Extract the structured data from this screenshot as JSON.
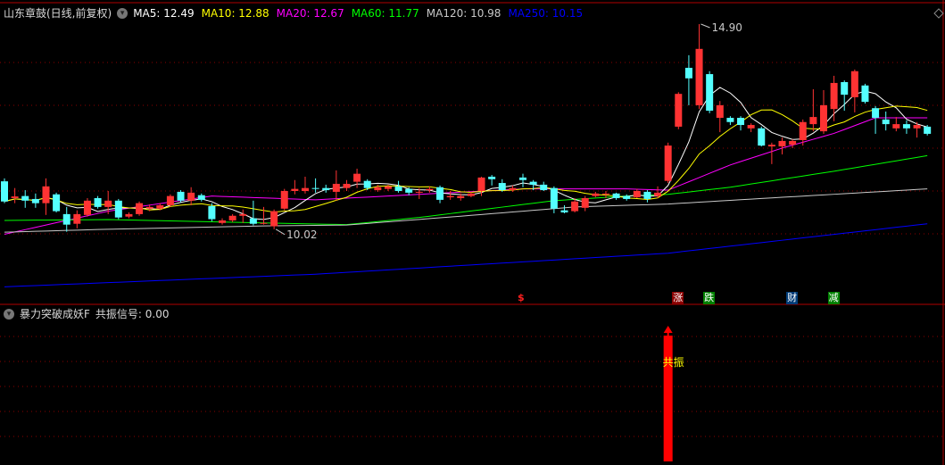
{
  "header": {
    "title": "山东章鼓(日线,前复权)",
    "ma_labels": [
      {
        "text": "MA5: 12.49",
        "color": "#ffffff"
      },
      {
        "text": "MA10: 12.88",
        "color": "#ffff00"
      },
      {
        "text": "MA20: 12.67",
        "color": "#ff00ff"
      },
      {
        "text": "MA60: 11.77",
        "color": "#00ff00"
      },
      {
        "text": "MA120: 10.98",
        "color": "#c8c8c8"
      },
      {
        "text": "MA250: 10.15",
        "color": "#0000ff"
      }
    ]
  },
  "indicator": {
    "title": "暴力突破成妖F",
    "value_label": "共振信号: 0.00",
    "bar_label": "共振"
  },
  "colors": {
    "up": "#ff3333",
    "down": "#54ffff",
    "grid": "#8b0000",
    "border": "#b00000"
  },
  "chart_data": {
    "type": "candlestick",
    "title": "山东章鼓(日线,前复权)",
    "price_range": [
      8.57,
      15.47
    ],
    "annotations": [
      {
        "label": "14.90",
        "index": 67,
        "price": 14.9,
        "kind": "high"
      },
      {
        "label": "10.02",
        "index": 26,
        "price": 10.02,
        "kind": "low"
      }
    ],
    "candles": [
      [
        11.16,
        11.23,
        10.64,
        10.68
      ],
      [
        10.76,
        11.0,
        10.64,
        10.8
      ],
      [
        10.81,
        10.95,
        10.53,
        10.7
      ],
      [
        10.74,
        10.87,
        10.53,
        10.64
      ],
      [
        10.64,
        11.23,
        10.36,
        11.04
      ],
      [
        10.85,
        10.89,
        10.42,
        10.45
      ],
      [
        10.38,
        10.55,
        9.96,
        10.13
      ],
      [
        10.15,
        10.47,
        10.04,
        10.38
      ],
      [
        10.36,
        10.76,
        10.32,
        10.7
      ],
      [
        10.76,
        10.81,
        10.51,
        10.55
      ],
      [
        10.55,
        10.93,
        10.38,
        10.7
      ],
      [
        10.7,
        10.74,
        10.26,
        10.3
      ],
      [
        10.32,
        10.42,
        10.28,
        10.38
      ],
      [
        10.38,
        10.68,
        10.34,
        10.64
      ],
      [
        10.51,
        10.61,
        10.45,
        10.55
      ],
      [
        10.51,
        10.64,
        10.47,
        10.59
      ],
      [
        10.59,
        10.85,
        10.55,
        10.81
      ],
      [
        10.91,
        10.95,
        10.66,
        10.7
      ],
      [
        10.7,
        11.02,
        10.59,
        10.89
      ],
      [
        10.83,
        10.87,
        10.68,
        10.72
      ],
      [
        10.57,
        10.64,
        10.21,
        10.26
      ],
      [
        10.17,
        10.28,
        10.13,
        10.23
      ],
      [
        10.23,
        10.38,
        10.19,
        10.34
      ],
      [
        10.34,
        10.49,
        10.17,
        10.38
      ],
      [
        10.28,
        10.7,
        10.11,
        10.15
      ],
      [
        10.15,
        10.55,
        10.13,
        10.17
      ],
      [
        10.09,
        10.49,
        10.02,
        10.45
      ],
      [
        10.51,
        10.98,
        10.47,
        10.93
      ],
      [
        10.93,
        11.19,
        10.85,
        10.98
      ],
      [
        10.93,
        11.27,
        10.87,
        11.0
      ],
      [
        11.0,
        11.23,
        10.89,
        10.98
      ],
      [
        11.0,
        11.08,
        10.89,
        10.95
      ],
      [
        10.91,
        11.42,
        10.7,
        11.1
      ],
      [
        11.0,
        11.19,
        10.93,
        11.1
      ],
      [
        11.15,
        11.46,
        11.0,
        11.34
      ],
      [
        11.17,
        11.21,
        10.95,
        11.0
      ],
      [
        10.95,
        11.08,
        10.91,
        11.02
      ],
      [
        10.98,
        11.08,
        10.93,
        11.04
      ],
      [
        11.04,
        11.17,
        10.89,
        10.93
      ],
      [
        10.98,
        11.02,
        10.83,
        10.89
      ],
      [
        10.89,
        11.0,
        10.74,
        10.91
      ],
      [
        10.95,
        11.04,
        10.89,
        10.98
      ],
      [
        11.02,
        11.06,
        10.64,
        10.72
      ],
      [
        10.78,
        10.93,
        10.72,
        10.81
      ],
      [
        10.76,
        10.87,
        10.7,
        10.81
      ],
      [
        10.81,
        10.91,
        10.78,
        10.87
      ],
      [
        10.93,
        11.27,
        10.81,
        11.25
      ],
      [
        11.27,
        11.31,
        11.06,
        11.21
      ],
      [
        11.12,
        11.21,
        10.91,
        10.95
      ],
      [
        10.95,
        11.06,
        10.91,
        11.0
      ],
      [
        11.25,
        11.34,
        11.02,
        11.19
      ],
      [
        11.15,
        11.19,
        10.95,
        11.08
      ],
      [
        11.08,
        11.15,
        10.93,
        10.95
      ],
      [
        11.0,
        11.04,
        10.4,
        10.51
      ],
      [
        10.47,
        10.59,
        10.4,
        10.42
      ],
      [
        10.45,
        10.76,
        10.42,
        10.68
      ],
      [
        10.53,
        10.81,
        10.45,
        10.76
      ],
      [
        10.81,
        10.91,
        10.78,
        10.87
      ],
      [
        10.85,
        10.93,
        10.76,
        10.87
      ],
      [
        10.87,
        10.89,
        10.72,
        10.76
      ],
      [
        10.81,
        10.85,
        10.7,
        10.74
      ],
      [
        10.78,
        10.98,
        10.76,
        10.93
      ],
      [
        10.91,
        10.95,
        10.66,
        10.74
      ],
      [
        10.81,
        11.04,
        10.76,
        10.89
      ],
      [
        11.17,
        12.08,
        11.12,
        12.01
      ],
      [
        12.46,
        13.28,
        12.4,
        13.24
      ],
      [
        13.86,
        14.16,
        12.97,
        13.61
      ],
      [
        12.97,
        14.9,
        12.88,
        14.31
      ],
      [
        13.71,
        13.78,
        12.78,
        12.84
      ],
      [
        12.67,
        13.07,
        12.33,
        12.97
      ],
      [
        12.67,
        12.71,
        12.5,
        12.57
      ],
      [
        12.67,
        12.71,
        12.37,
        12.5
      ],
      [
        12.42,
        12.54,
        12.33,
        12.5
      ],
      [
        12.42,
        12.46,
        11.99,
        12.01
      ],
      [
        11.99,
        12.08,
        11.57,
        12.03
      ],
      [
        11.99,
        12.2,
        11.8,
        12.12
      ],
      [
        12.03,
        12.16,
        11.95,
        12.12
      ],
      [
        12.14,
        12.63,
        12.01,
        12.57
      ],
      [
        12.52,
        13.35,
        12.35,
        12.69
      ],
      [
        12.35,
        13.33,
        12.29,
        12.97
      ],
      [
        12.88,
        13.67,
        12.59,
        13.5
      ],
      [
        13.52,
        13.56,
        12.84,
        13.22
      ],
      [
        13.16,
        13.82,
        12.8,
        13.78
      ],
      [
        13.44,
        13.48,
        13.01,
        13.05
      ],
      [
        12.9,
        12.95,
        12.29,
        12.67
      ],
      [
        12.63,
        12.82,
        12.37,
        12.52
      ],
      [
        12.42,
        12.69,
        12.35,
        12.52
      ],
      [
        12.52,
        12.61,
        12.29,
        12.42
      ],
      [
        12.42,
        12.57,
        12.2,
        12.5
      ],
      [
        12.46,
        12.5,
        12.25,
        12.29
      ]
    ],
    "ma_computed": [
      {
        "name": "MA5",
        "period": 5,
        "color": "#ffffff"
      },
      {
        "name": "MA10",
        "period": 10,
        "color": "#ffff00"
      }
    ],
    "ma_keypoints": [
      {
        "name": "MA20",
        "color": "#ff00ff",
        "points": [
          [
            0,
            9.9
          ],
          [
            10,
            10.45
          ],
          [
            20,
            10.81
          ],
          [
            30,
            10.72
          ],
          [
            40,
            10.85
          ],
          [
            50,
            10.98
          ],
          [
            60,
            10.98
          ],
          [
            64,
            10.95
          ],
          [
            70,
            11.55
          ],
          [
            75,
            11.95
          ],
          [
            80,
            12.3
          ],
          [
            84,
            12.67
          ],
          [
            89,
            12.67
          ]
        ]
      },
      {
        "name": "MA60",
        "color": "#00ff00",
        "points": [
          [
            0,
            10.23
          ],
          [
            10,
            10.25
          ],
          [
            25,
            10.17
          ],
          [
            33,
            10.13
          ],
          [
            40,
            10.3
          ],
          [
            53,
            10.7
          ],
          [
            60,
            10.81
          ],
          [
            64,
            10.85
          ],
          [
            70,
            11.02
          ],
          [
            80,
            11.4
          ],
          [
            89,
            11.77
          ]
        ]
      },
      {
        "name": "MA120",
        "color": "#c8c8c8",
        "points": [
          [
            0,
            9.95
          ],
          [
            10,
            10.02
          ],
          [
            25,
            10.1
          ],
          [
            33,
            10.12
          ],
          [
            45,
            10.35
          ],
          [
            55,
            10.55
          ],
          [
            64,
            10.62
          ],
          [
            75,
            10.78
          ],
          [
            89,
            10.98
          ]
        ]
      },
      {
        "name": "MA250",
        "color": "#0000ff",
        "points": [
          [
            0,
            8.65
          ],
          [
            30,
            8.95
          ],
          [
            64,
            9.45
          ],
          [
            89,
            10.15
          ]
        ]
      }
    ],
    "signals": [
      {
        "index": 50,
        "text": "$",
        "bg": "",
        "color": "#ff2020"
      },
      {
        "index": 65,
        "text": "涨",
        "bg": "#8b0000",
        "color": "#ffffff"
      },
      {
        "index": 68,
        "text": "跌",
        "bg": "#008000",
        "color": "#ffffff"
      },
      {
        "index": 76,
        "text": "财",
        "bg": "#003c78",
        "color": "#ffffff"
      },
      {
        "index": 80,
        "text": "减",
        "bg": "#008000",
        "color": "#ffffff"
      }
    ],
    "resonance": [
      {
        "index": 64,
        "value": 1
      }
    ]
  }
}
